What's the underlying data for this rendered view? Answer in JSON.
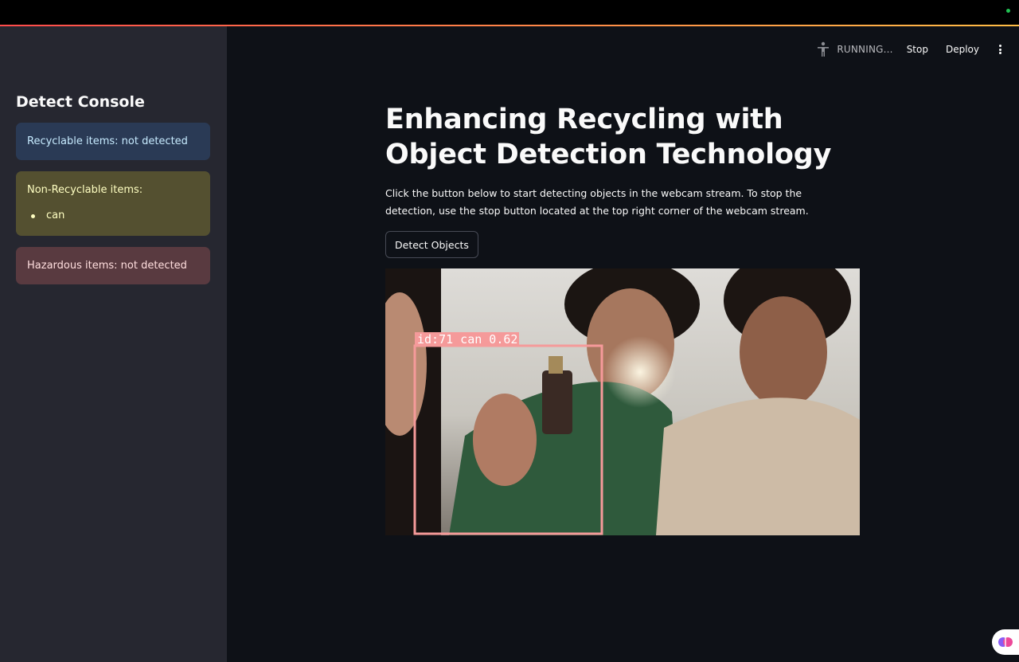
{
  "header": {
    "status_label": "RUNNING...",
    "stop_label": "Stop",
    "deploy_label": "Deploy",
    "menu_icon": "kebab-menu-icon",
    "running_icon": "running-person-icon"
  },
  "sidebar": {
    "title": "Detect Console",
    "recyclable": "Recyclable items: not detected",
    "non_recyclable": {
      "label": "Non-Recyclable items:",
      "items": [
        "can"
      ]
    },
    "hazardous": "Hazardous items: not detected"
  },
  "main": {
    "title": "Enhancing Recycling with Object Detection Technology",
    "description": "Click the button below to start detecting objects in the webcam stream. To stop the detection, use the stop button located at the top right corner of the webcam stream.",
    "detect_button": "Detect Objects"
  },
  "webcam": {
    "detection_label": "id:71 can 0.62",
    "box_color": "#f59a9a"
  },
  "colors": {
    "accent": "#ff4b4b",
    "info_bg": "#2a3a55",
    "warning_bg": "#545030",
    "error_bg": "#593a40"
  }
}
